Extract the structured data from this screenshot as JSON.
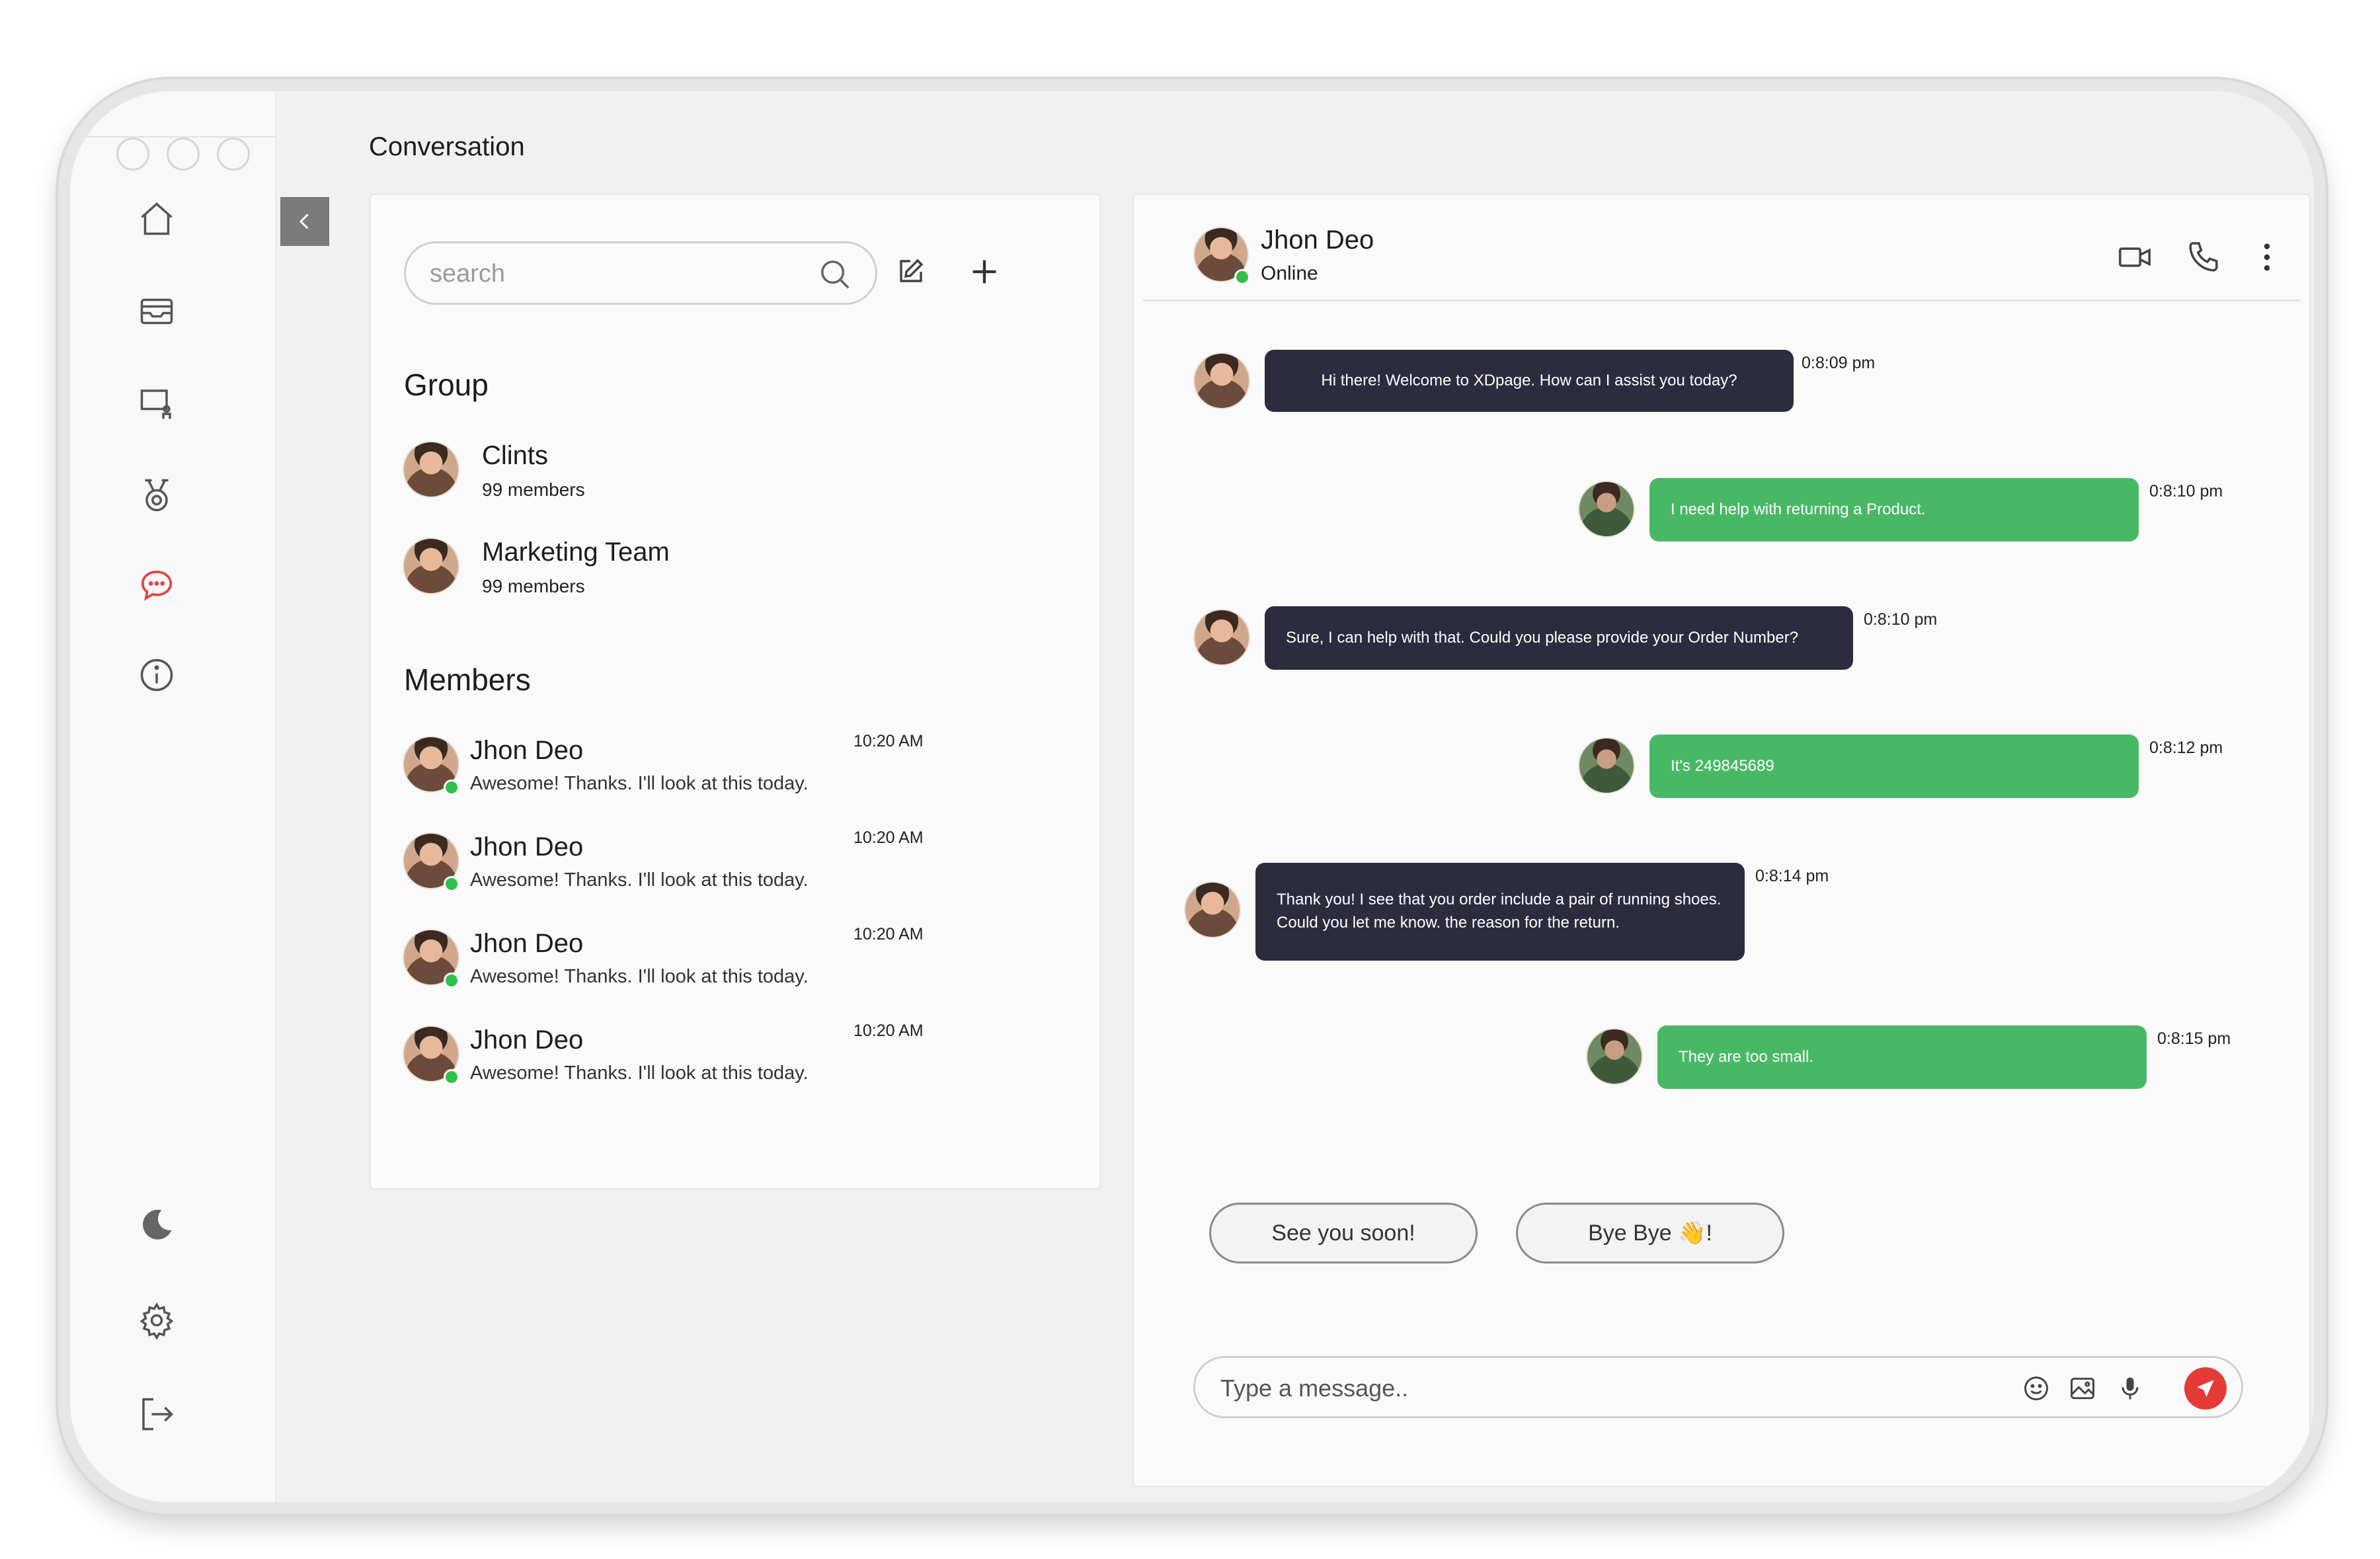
{
  "page": {
    "title": "Conversation"
  },
  "search": {
    "placeholder": "search"
  },
  "groups": {
    "heading": "Group",
    "items": [
      {
        "name": "Clints",
        "members": "99 members"
      },
      {
        "name": "Marketing Team",
        "members": "99 members"
      }
    ]
  },
  "members": {
    "heading": "Members",
    "items": [
      {
        "name": "Jhon Deo",
        "message": "Awesome! Thanks. I'll look at this today.",
        "time": "10:20 AM"
      },
      {
        "name": "Jhon Deo",
        "message": "Awesome! Thanks. I'll look at this today.",
        "time": "10:20 AM"
      },
      {
        "name": "Jhon Deo",
        "message": "Awesome! Thanks. I'll look at this today.",
        "time": "10:20 AM"
      },
      {
        "name": "Jhon Deo",
        "message": "Awesome! Thanks. I'll look at this today.",
        "time": "10:20 AM"
      }
    ]
  },
  "chat": {
    "contact_name": "Jhon Deo",
    "contact_status": "Online",
    "messages": [
      {
        "from": "agent",
        "text": "Hi there! Welcome to XDpage. How can I assist you today?",
        "time": "0:8:09 pm"
      },
      {
        "from": "user",
        "text": "I need help with returning a Product.",
        "time": "0:8:10 pm"
      },
      {
        "from": "agent",
        "text": "Sure, I can help with that. Could you please provide your Order Number?",
        "time": "0:8:10 pm"
      },
      {
        "from": "user",
        "text": "It's 249845689",
        "time": "0:8:12 pm"
      },
      {
        "from": "agent",
        "text": "Thank you! I see that you order include a pair of running shoes. Could you let me know. the reason for the return.",
        "time": "0:8:14 pm"
      },
      {
        "from": "user",
        "text": "They are too small.",
        "time": "0:8:15 pm"
      }
    ],
    "quick_replies": [
      "See  you soon!",
      "Bye Bye 👋!"
    ],
    "composer_placeholder": "Type a message.."
  },
  "icons": {
    "sidebar": [
      "home-icon",
      "inbox-icon",
      "presentation-icon",
      "award-icon",
      "chat-icon",
      "info-icon",
      "moon-icon",
      "gear-icon",
      "logout-icon"
    ],
    "active": "chat-icon"
  },
  "colors": {
    "agent_bubble": "#2d2c3e",
    "user_bubble": "#49b865",
    "send_button": "#e53b37",
    "active_icon": "#e0463f",
    "online": "#2fbf4a"
  }
}
